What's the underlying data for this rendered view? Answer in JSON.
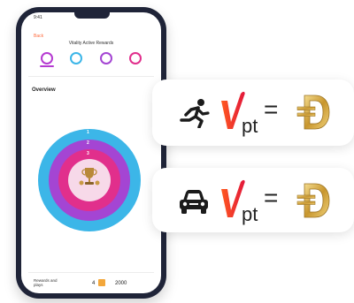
{
  "phone": {
    "status_time": "9:41",
    "back_label": "Back",
    "title": "Vitality Active Rewards",
    "overview_label": "Overview",
    "ring_labels": [
      "1",
      "2",
      "3"
    ],
    "bottom": {
      "label": "Rewards and plays",
      "count": "4",
      "points": "2000"
    }
  },
  "equations": [
    {
      "icon": "running-person-icon",
      "vpt_main": "V",
      "vpt_sub": "pt",
      "equals": "="
    },
    {
      "icon": "car-icon",
      "vpt_main": "V",
      "vpt_sub": "pt",
      "equals": "="
    }
  ],
  "colors": {
    "accent_orange": "#ff5a1f",
    "accent_red": "#e2173b",
    "ring_outer": "#3cb6e8",
    "ring_middle": "#a445d3",
    "ring_inner": "#e12f8c",
    "coin_gold": "#d8b24c"
  }
}
